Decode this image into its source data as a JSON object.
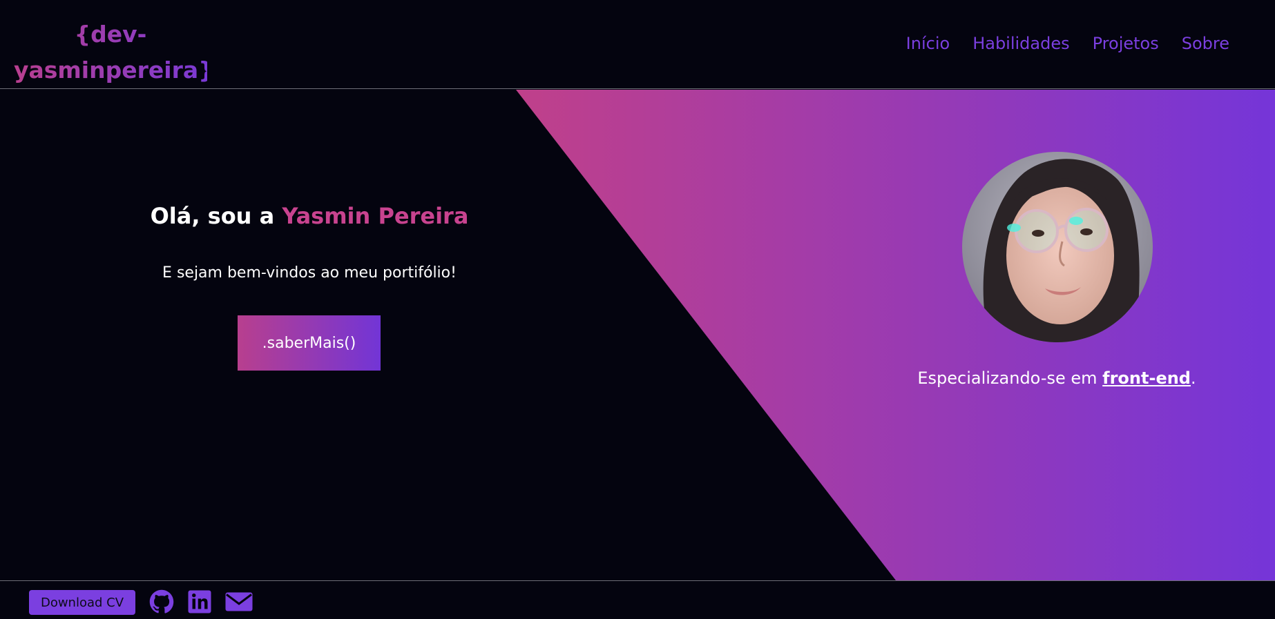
{
  "header": {
    "logo_line1": "{dev-",
    "logo_line2": "yasminpereira}",
    "nav": [
      {
        "label": "Início"
      },
      {
        "label": "Habilidades"
      },
      {
        "label": "Projetos"
      },
      {
        "label": "Sobre"
      }
    ]
  },
  "hero": {
    "greeting_prefix": "Olá, sou a ",
    "greeting_name": "Yasmin Pereira",
    "welcome": "E sejam bem-vindos ao meu portifólio!",
    "cta_label": ".saberMais()",
    "specialty_prefix": "Especializando-se em ",
    "specialty_highlight": "front-end",
    "specialty_suffix": "."
  },
  "footer": {
    "download_label": "Download CV",
    "icons": [
      "github-icon",
      "linkedin-icon",
      "email-icon"
    ]
  },
  "colors": {
    "background": "#04040f",
    "accent_purple": "#7b3fe0",
    "accent_pink": "#c8438f",
    "gradient_start": "#b93f8f",
    "gradient_end": "#7535d8"
  }
}
